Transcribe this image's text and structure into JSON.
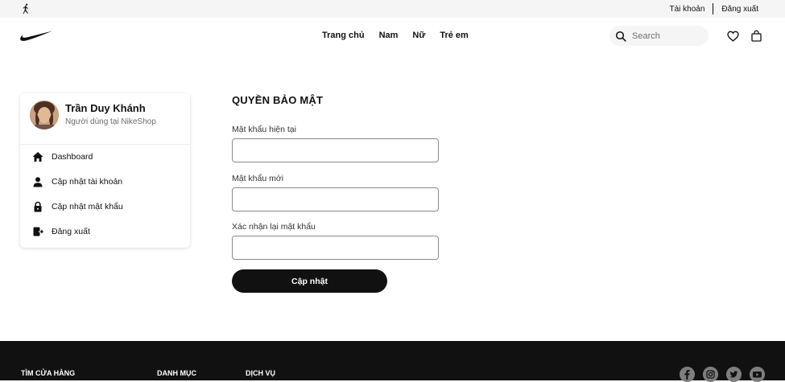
{
  "topbar": {
    "account_label": "Tài khoản",
    "logout_label": "Đăng xuất"
  },
  "header": {
    "nav": [
      "Trang chủ",
      "Nam",
      "Nữ",
      "Trẻ em"
    ],
    "search_placeholder": "Search"
  },
  "profile": {
    "name": "Trần Duy Khánh",
    "role": "Người dùng tại NikeShop",
    "menu": [
      {
        "label": "Dashboard",
        "icon": "home-icon"
      },
      {
        "label": "Cập nhật tài khoản",
        "icon": "user-icon"
      },
      {
        "label": "Cập nhật mật khẩu",
        "icon": "lock-icon"
      },
      {
        "label": "Đăng xuất",
        "icon": "logout-icon"
      }
    ]
  },
  "form": {
    "title": "QUYỀN BẢO MẬT",
    "current_password_label": "Mật khẩu hiện tại",
    "new_password_label": "Mật khẩu mới",
    "confirm_password_label": "Xác nhận lại mật khẩu",
    "submit_label": "Cập nhật"
  },
  "footer": {
    "headings": [
      "TÌM CỬA HÀNG",
      "DANH MỤC",
      "DỊCH VỤ"
    ],
    "social": [
      "facebook-icon",
      "instagram-icon",
      "twitter-icon",
      "youtube-icon"
    ]
  },
  "colors": {
    "primary": "#111111",
    "topbar_bg": "#f5f5f5",
    "footer_bg": "#111111"
  }
}
